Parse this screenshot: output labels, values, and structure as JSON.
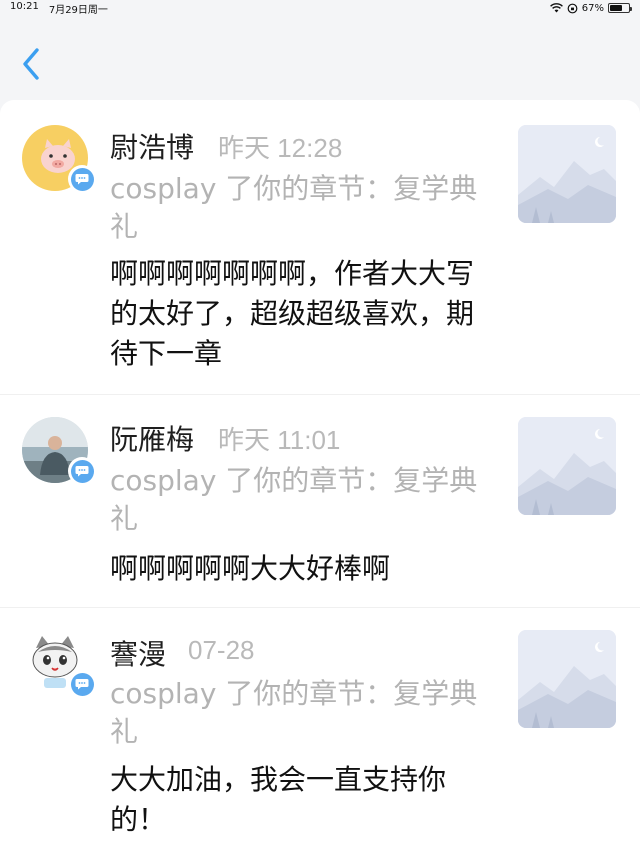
{
  "status_bar": {
    "time": "10:21",
    "date": "7月29日周一",
    "battery": "67%",
    "battery_level": 0.67
  },
  "nav": {
    "back_icon": "chevron-left-icon",
    "accent_color": "#3b9ff0"
  },
  "notifications": [
    {
      "user": "尉浩博",
      "time": "昨天 12:28",
      "action": "cosplay 了你的章节：复学典礼",
      "comment": "啊啊啊啊啊啊啊，作者大大写的太好了，超级超级喜欢，期待下一章",
      "avatar_icon": "pig-avatar-icon"
    },
    {
      "user": "阮雁梅",
      "time": "昨天 11:01",
      "action": "cosplay 了你的章节：复学典礼",
      "comment": "啊啊啊啊啊大大好棒啊",
      "avatar_icon": "person-photo-avatar-icon"
    },
    {
      "user": "謇漫",
      "time": "07-28",
      "action": "cosplay 了你的章节：复学典礼",
      "comment": "大大加油，我会一直支持你的！",
      "avatar_icon": "cat-avatar-icon"
    }
  ]
}
